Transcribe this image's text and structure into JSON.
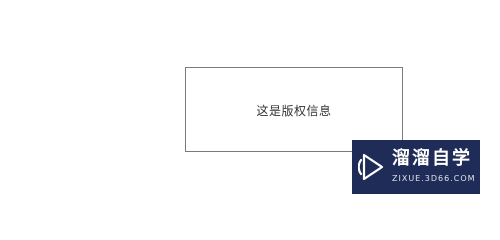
{
  "dialog": {
    "text": "这是版权信息"
  },
  "watermark": {
    "brand": "溜溜自学",
    "url": "ZIXUE.3D66.COM",
    "icon": "play-logo-icon",
    "background": "#1f2c57"
  }
}
